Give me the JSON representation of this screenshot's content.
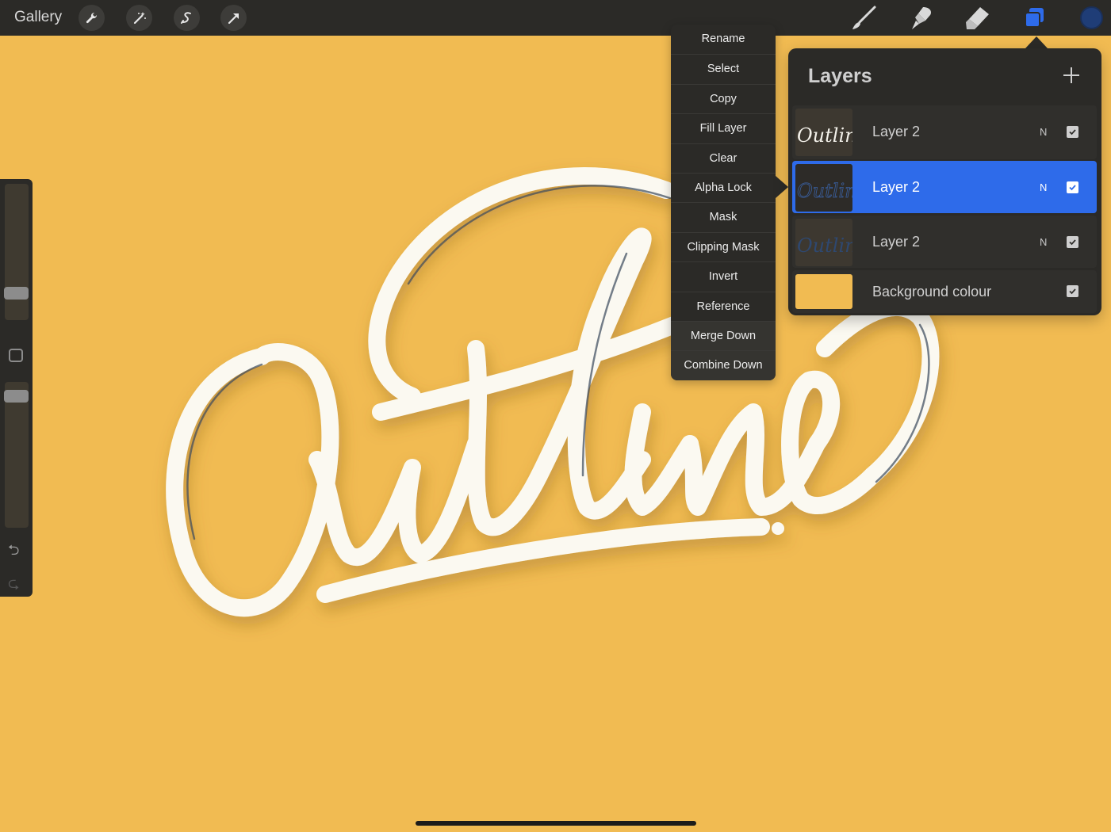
{
  "topbar": {
    "gallery_label": "Gallery",
    "left_tools": [
      "wrench-icon",
      "magic-wand-icon",
      "selection-icon",
      "transform-arrow-icon"
    ],
    "right_tools": [
      "brush-icon",
      "smudge-icon",
      "eraser-icon",
      "layers-icon"
    ],
    "current_color": "#1f3d77",
    "active_tool_color": "#2e6bea"
  },
  "canvas": {
    "background_color": "#f1bb52",
    "lettering": "Outline"
  },
  "context_menu": {
    "items": [
      "Rename",
      "Select",
      "Copy",
      "Fill Layer",
      "Clear",
      "Alpha Lock",
      "Mask",
      "Clipping Mask",
      "Invert",
      "Reference",
      "Merge Down",
      "Combine Down"
    ]
  },
  "layers_panel": {
    "title": "Layers",
    "layers": [
      {
        "name": "Layer 2",
        "mode": "N",
        "visible": true,
        "selected": false
      },
      {
        "name": "Layer 2",
        "mode": "N",
        "visible": true,
        "selected": true
      },
      {
        "name": "Layer 2",
        "mode": "N",
        "visible": true,
        "selected": false
      },
      {
        "name": "Background colour",
        "visible": true
      }
    ]
  }
}
